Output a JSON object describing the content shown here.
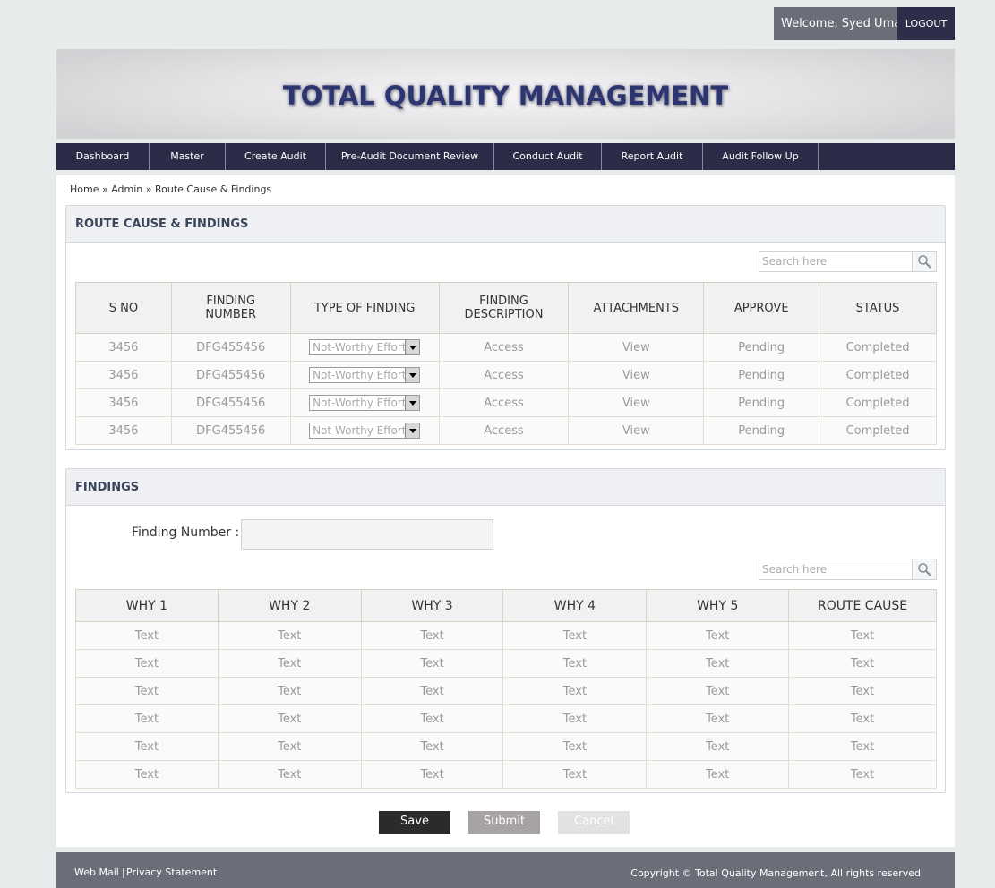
{
  "header": {
    "welcome": "Welcome, Syed Umar",
    "logout": "LOGOUT"
  },
  "banner": {
    "title": "TOTAL QUALITY MANAGEMENT",
    "title_color": "#2d3570"
  },
  "nav": [
    {
      "label": "Dashboard"
    },
    {
      "label": "Master"
    },
    {
      "label": "Create Audit"
    },
    {
      "label": "Pre-Audit Document Review"
    },
    {
      "label": "Conduct Audit"
    },
    {
      "label": "Report Audit"
    },
    {
      "label": "Audit Follow Up"
    }
  ],
  "breadcrumb": "Home » Admin » Route Cause & Findings",
  "route_panel": {
    "title": "ROUTE CAUSE & FINDINGS",
    "search_placeholder": "Search here",
    "columns": [
      {
        "line1": "S NO",
        "line2": ""
      },
      {
        "line1": "FINDING",
        "line2": "NUMBER"
      },
      {
        "line1": "TYPE OF FINDING",
        "line2": ""
      },
      {
        "line1": "FINDING",
        "line2": "DESCRIPTION"
      },
      {
        "line1": "ATTACHMENTS",
        "line2": ""
      },
      {
        "line1": "APPROVE",
        "line2": ""
      },
      {
        "line1": "STATUS",
        "line2": ""
      }
    ],
    "rows": [
      {
        "sno": "3456",
        "finding_number": "DFG455456",
        "type": "Not-Worthy Effort",
        "description": "Access",
        "attachments": "View",
        "approve": "Pending",
        "status": "Completed"
      },
      {
        "sno": "3456",
        "finding_number": "DFG455456",
        "type": "Not-Worthy Effort",
        "description": "Access",
        "attachments": "View",
        "approve": "Pending",
        "status": "Completed"
      },
      {
        "sno": "3456",
        "finding_number": "DFG455456",
        "type": "Not-Worthy Effort",
        "description": "Access",
        "attachments": "View",
        "approve": "Pending",
        "status": "Completed"
      },
      {
        "sno": "3456",
        "finding_number": "DFG455456",
        "type": "Not-Worthy Effort",
        "description": "Access",
        "attachments": "View",
        "approve": "Pending",
        "status": "Completed"
      }
    ]
  },
  "findings_panel": {
    "title": "FINDINGS",
    "finding_number_label": "Finding Number :",
    "finding_number_value": "",
    "search_placeholder": "Search here",
    "columns": [
      "WHY 1",
      "WHY 2",
      "WHY 3",
      "WHY 4",
      "WHY 5",
      "ROUTE CAUSE"
    ],
    "rows": [
      [
        "Text",
        "Text",
        "Text",
        "Text",
        "Text",
        "Text"
      ],
      [
        "Text",
        "Text",
        "Text",
        "Text",
        "Text",
        "Text"
      ],
      [
        "Text",
        "Text",
        "Text",
        "Text",
        "Text",
        "Text"
      ],
      [
        "Text",
        "Text",
        "Text",
        "Text",
        "Text",
        "Text"
      ],
      [
        "Text",
        "Text",
        "Text",
        "Text",
        "Text",
        "Text"
      ],
      [
        "Text",
        "Text",
        "Text",
        "Text",
        "Text",
        "Text"
      ]
    ]
  },
  "actions": {
    "save": "Save",
    "submit": "Submit",
    "cancel": "Cancel"
  },
  "footer": {
    "webmail": "Web Mail",
    "separator": "|",
    "privacy": "Privacy Statement",
    "copyright": "Copyright © Total Quality Management, All rights reserved"
  },
  "colors": {
    "nav_bg": "#2c2c48",
    "footer_bg": "#6a6e79",
    "save_bg": "#2b2b2b",
    "submit_bg": "#a8a3a3",
    "cancel_bg": "#e2e2e2"
  }
}
